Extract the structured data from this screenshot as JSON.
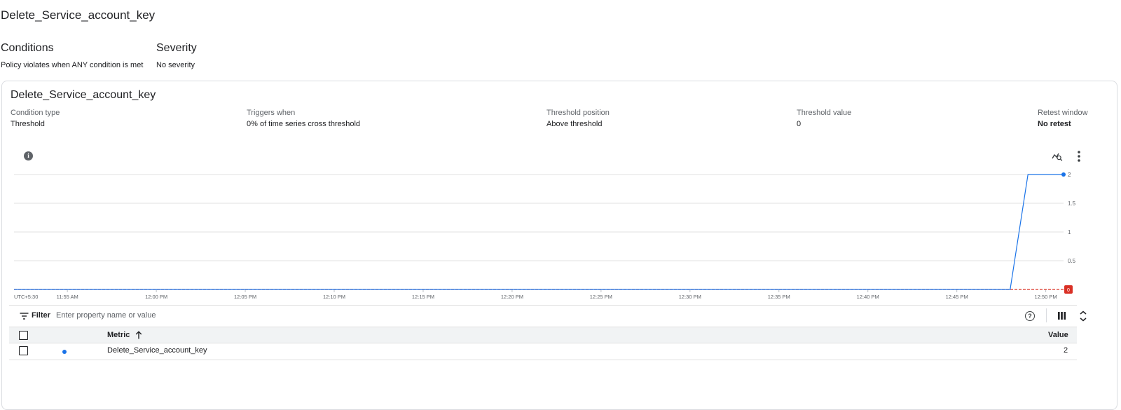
{
  "page": {
    "title": "Delete_Service_account_key"
  },
  "summary": {
    "conditions_title": "Conditions",
    "conditions_text": "Policy violates when ANY condition is met",
    "severity_title": "Severity",
    "severity_text": "No severity"
  },
  "condition": {
    "title": "Delete_Service_account_key",
    "properties": [
      {
        "label": "Condition type",
        "value": "Threshold"
      },
      {
        "label": "Triggers when",
        "value": "0% of time series cross threshold"
      },
      {
        "label": "Threshold position",
        "value": "Above threshold"
      },
      {
        "label": "Threshold value",
        "value": "0"
      },
      {
        "label": "Retest window",
        "value": "No retest"
      }
    ]
  },
  "icons": {
    "info": "info-icon",
    "explore": "explore-chart-icon",
    "more": "more-vert-icon",
    "filter": "filter-icon",
    "help": "help-icon",
    "columns": "columns-icon",
    "collapse": "collapse-icon",
    "sort": "arrow-up-icon"
  },
  "colors": {
    "series": "#1a73e8",
    "threshold": "#d93025",
    "grid": "#e0e0e0"
  },
  "chart_data": {
    "type": "line",
    "timezone_label": "UTC+5:30",
    "x_tick_labels": [
      "11:55 AM",
      "12:00 PM",
      "12:05 PM",
      "12:10 PM",
      "12:15 PM",
      "12:20 PM",
      "12:25 PM",
      "12:30 PM",
      "12:35 PM",
      "12:40 PM",
      "12:45 PM",
      "12:50 PM"
    ],
    "y_tick_labels": [
      "2",
      "1.5",
      "1",
      "0.5"
    ],
    "ylim": [
      0,
      2
    ],
    "series": [
      {
        "name": "Delete_Service_account_key",
        "x": [
          "11:52 AM",
          "12:48 PM",
          "12:49 PM",
          "12:51 PM"
        ],
        "y": [
          0,
          0,
          2,
          2
        ]
      }
    ],
    "threshold": {
      "value": 0,
      "label": "0"
    }
  },
  "filter": {
    "label": "Filter",
    "placeholder": "Enter property name or value",
    "help_glyph": "?"
  },
  "table": {
    "columns": {
      "metric": "Metric",
      "value": "Value"
    },
    "rows": [
      {
        "metric": "Delete_Service_account_key",
        "value": "2"
      }
    ]
  }
}
